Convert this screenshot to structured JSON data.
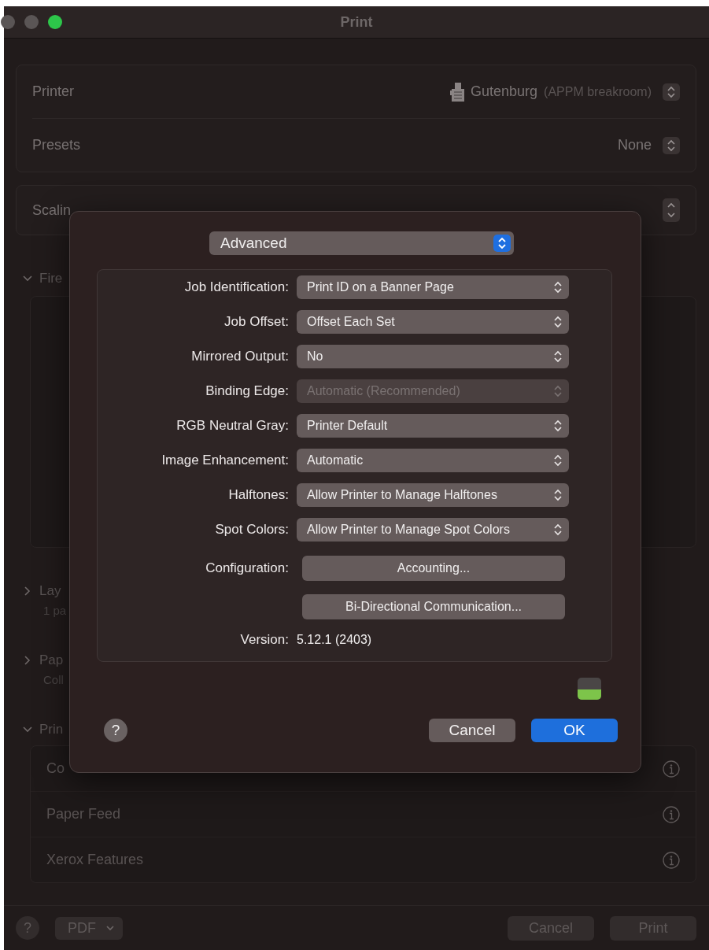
{
  "window": {
    "title": "Print"
  },
  "printer": {
    "label": "Printer",
    "name": "Gutenburg",
    "location": "(APPM breakroom)"
  },
  "presets": {
    "label": "Presets",
    "value": "None"
  },
  "scaling": {
    "label": "Scalin"
  },
  "sections": [
    {
      "title": "Fire",
      "expanded": true,
      "kind": "box"
    },
    {
      "title": "Lay",
      "subtitle": "1 pa",
      "expanded": false,
      "kind": "collapsed"
    },
    {
      "title": "Pap",
      "subtitle": "Coll",
      "expanded": false,
      "kind": "collapsed"
    },
    {
      "title": "Prin",
      "expanded": true,
      "kind": "list",
      "items": [
        "Co",
        "Paper Feed",
        "Xerox Features"
      ]
    }
  ],
  "sheet": {
    "panel": "Advanced",
    "options": [
      {
        "label": "Job Identification:",
        "value": "Print ID on a Banner Page",
        "disabled": false
      },
      {
        "label": "Job Offset:",
        "value": "Offset Each Set",
        "disabled": false
      },
      {
        "label": "Mirrored Output:",
        "value": "No",
        "disabled": false
      },
      {
        "label": "Binding Edge:",
        "value": "Automatic (Recommended)",
        "disabled": true
      },
      {
        "label": "RGB Neutral Gray:",
        "value": "Printer Default",
        "disabled": false
      },
      {
        "label": "Image Enhancement:",
        "value": "Automatic",
        "disabled": false
      },
      {
        "label": "Halftones:",
        "value": "Allow Printer to Manage Halftones",
        "disabled": false
      },
      {
        "label": "Spot Colors:",
        "value": "Allow Printer to Manage Spot Colors",
        "disabled": false
      }
    ],
    "configuration_label": "Configuration:",
    "buttons": [
      "Accounting...",
      "Bi-Directional Communication..."
    ],
    "version_label": "Version:",
    "version": "5.12.1 (2403)",
    "help": "?",
    "cancel": "Cancel",
    "ok": "OK"
  },
  "footer": {
    "help": "?",
    "pdf": "PDF",
    "cancel": "Cancel",
    "print": "Print"
  }
}
